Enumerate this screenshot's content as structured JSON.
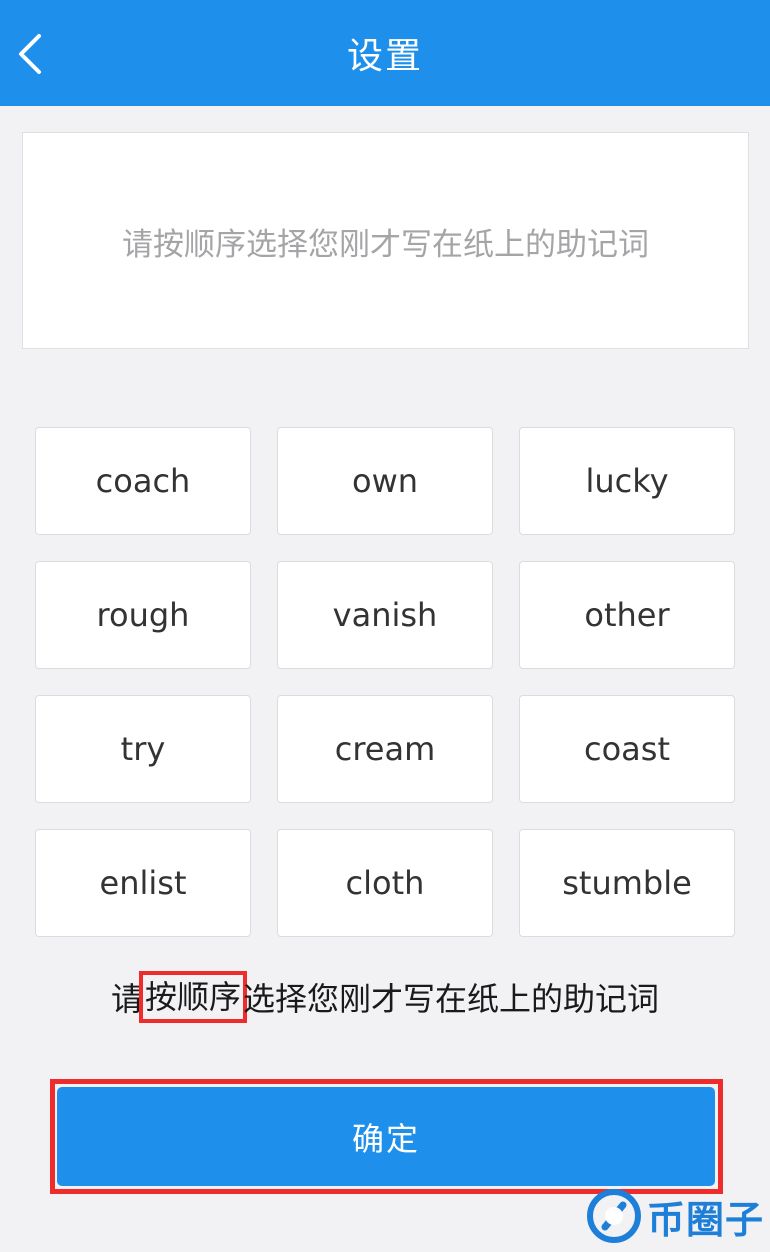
{
  "header": {
    "title": "设置",
    "back_icon": "chevron-left-icon"
  },
  "mnemonic_area": {
    "placeholder": "请按顺序选择您刚才写在纸上的助记词"
  },
  "words": [
    "coach",
    "own",
    "lucky",
    "rough",
    "vanish",
    "other",
    "try",
    "cream",
    "coast",
    "enlist",
    "cloth",
    "stumble"
  ],
  "hint": {
    "before": "请",
    "highlight": "按顺序",
    "after": "选择您刚才写在纸上的助记词"
  },
  "confirm": {
    "label": "确定"
  },
  "watermark": {
    "text": "币圈子",
    "logo_icon": "coin-logo-icon"
  },
  "colors": {
    "primary": "#1e90ec",
    "highlight_border": "#ee2c2c",
    "background": "#f2f2f4"
  }
}
